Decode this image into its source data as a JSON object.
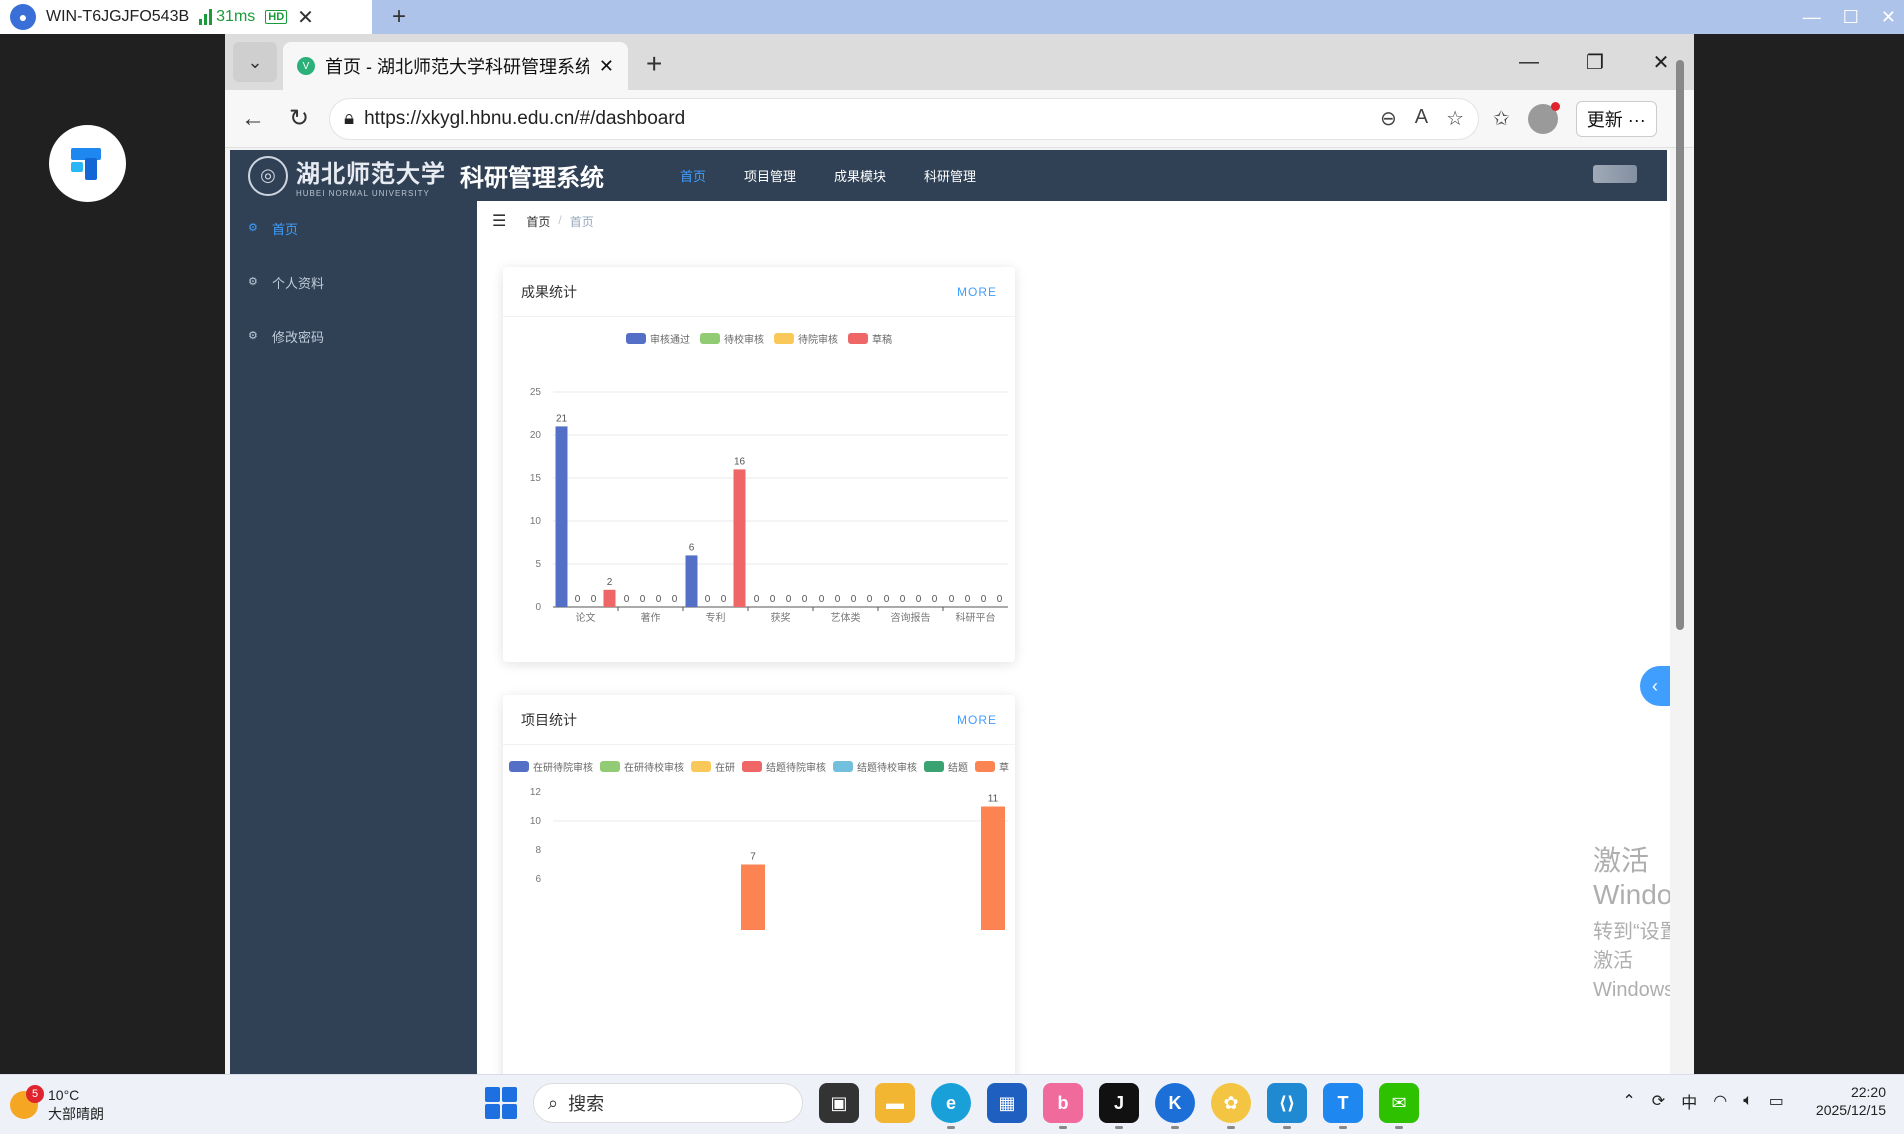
{
  "remote": {
    "host": "WIN-T6JGJFO543B",
    "latency": "31ms",
    "quality": "HD"
  },
  "browser": {
    "tab_title": "首页 - 湖北师范大学科研管理系统",
    "url": "https://xkygl.hbnu.edu.cn/#/dashboard",
    "update_label": "更新"
  },
  "app": {
    "logo_cn": "湖北师范大学",
    "logo_en": "HUBEI NORMAL UNIVERSITY",
    "system_name": "科研管理系统",
    "menu": [
      "首页",
      "项目管理",
      "成果模块",
      "科研管理"
    ],
    "sidebar": [
      "首页",
      "个人资料",
      "修改密码"
    ],
    "breadcrumb": [
      "首页",
      "首页"
    ]
  },
  "cards": {
    "achievements": {
      "title": "成果统计",
      "more": "MORE",
      "legend": [
        {
          "name": "审核通过",
          "color": "#5470c6"
        },
        {
          "name": "待校审核",
          "color": "#91cc75"
        },
        {
          "name": "待院审核",
          "color": "#fac858"
        },
        {
          "name": "草稿",
          "color": "#ee6666"
        }
      ]
    },
    "projects": {
      "title": "项目统计",
      "more": "MORE",
      "legend": [
        {
          "name": "在研待院审核",
          "color": "#5470c6"
        },
        {
          "name": "在研待校审核",
          "color": "#91cc75"
        },
        {
          "name": "在研",
          "color": "#fac858"
        },
        {
          "name": "结题待院审核",
          "color": "#ee6666"
        },
        {
          "name": "结题待校审核",
          "color": "#73c0de"
        },
        {
          "name": "结题",
          "color": "#3ba272"
        },
        {
          "name": "草",
          "color": "#fc8452"
        }
      ]
    }
  },
  "chart_data": [
    {
      "type": "bar",
      "categories": [
        "论文",
        "著作",
        "专利",
        "获奖",
        "艺体类",
        "咨询报告",
        "科研平台"
      ],
      "series": [
        {
          "name": "审核通过",
          "values": [
            21,
            0,
            6,
            0,
            0,
            0,
            0
          ]
        },
        {
          "name": "待校审核",
          "values": [
            0,
            0,
            0,
            0,
            0,
            0,
            0
          ]
        },
        {
          "name": "待院审核",
          "values": [
            0,
            0,
            0,
            0,
            0,
            0,
            0
          ]
        },
        {
          "name": "草稿",
          "values": [
            2,
            0,
            16,
            0,
            0,
            0,
            0
          ]
        }
      ],
      "yticks": [
        0,
        5,
        10,
        15,
        20,
        25
      ],
      "ylim": [
        0,
        25
      ]
    },
    {
      "type": "bar",
      "yticks": [
        6,
        8,
        10,
        12
      ],
      "visible_bars": [
        {
          "series": "草",
          "value": 7
        },
        {
          "series": "草",
          "value": 11
        }
      ]
    }
  ],
  "watermark": {
    "line1": "激活 Windows",
    "line2": "转到“设置”以激活 Windows。"
  },
  "taskbar": {
    "temperature": "10°C",
    "weather": "大部晴朗",
    "weather_badge": "5",
    "search_placeholder": "搜索",
    "ime": "中",
    "time": "22:20",
    "date": "2025/12/15"
  }
}
